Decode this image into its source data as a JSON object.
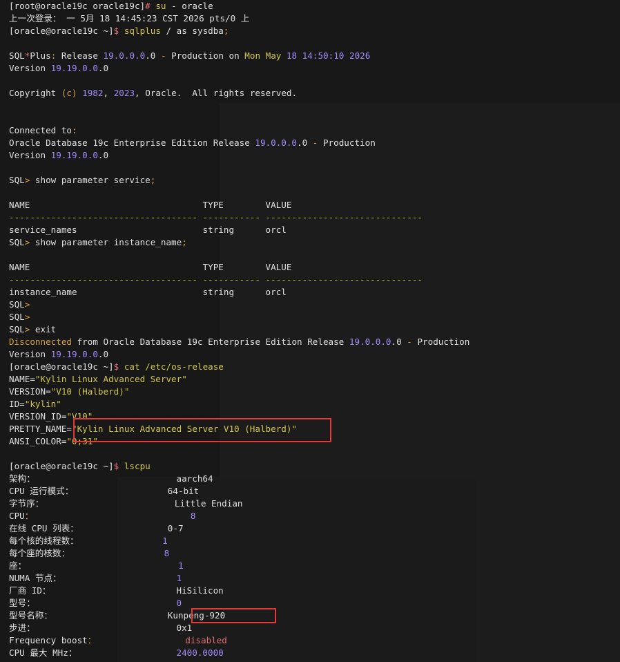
{
  "terminal": {
    "lines": [
      {
        "segments": [
          {
            "t": "[root@oracle19c oracle19c]",
            "c": "w"
          },
          {
            "t": "# ",
            "c": "r"
          },
          {
            "t": "su",
            "c": "y"
          },
          {
            "t": " - oracle",
            "c": "w"
          }
        ]
      },
      {
        "segments": [
          {
            "t": "上一次登录： 一 5月 18 14:45:23 CST 2026 pts/0 上",
            "c": "w"
          }
        ]
      },
      {
        "segments": [
          {
            "t": "[oracle@oracle19c ~]",
            "c": "w"
          },
          {
            "t": "$ ",
            "c": "r"
          },
          {
            "t": "sqlplus",
            "c": "y"
          },
          {
            "t": " / as sysdba",
            "c": "w"
          },
          {
            "t": ";",
            "c": "o"
          }
        ]
      },
      {
        "segments": [
          {
            "t": "",
            "c": "w"
          }
        ]
      },
      {
        "segments": [
          {
            "t": "SQL",
            "c": "w"
          },
          {
            "t": "*",
            "c": "r"
          },
          {
            "t": "Plus",
            "c": "w"
          },
          {
            "t": ":",
            "c": "o"
          },
          {
            "t": " Release ",
            "c": "w"
          },
          {
            "t": "19.0.0.0",
            "c": "p"
          },
          {
            "t": ".0 ",
            "c": "w"
          },
          {
            "t": "-",
            "c": "o"
          },
          {
            "t": " Production on ",
            "c": "w"
          },
          {
            "t": "Mon May ",
            "c": "g"
          },
          {
            "t": "18",
            "c": "p"
          },
          {
            "t": " ",
            "c": "w"
          },
          {
            "t": "14:50:10",
            "c": "p"
          },
          {
            "t": " ",
            "c": "w"
          },
          {
            "t": "2026",
            "c": "p"
          }
        ]
      },
      {
        "segments": [
          {
            "t": "Version ",
            "c": "w"
          },
          {
            "t": "19.19.0.0",
            "c": "p"
          },
          {
            "t": ".0",
            "c": "w"
          }
        ]
      },
      {
        "segments": [
          {
            "t": "",
            "c": "w"
          }
        ]
      },
      {
        "segments": [
          {
            "t": "Copyright ",
            "c": "w"
          },
          {
            "t": "(c)",
            "c": "o"
          },
          {
            "t": " ",
            "c": "w"
          },
          {
            "t": "1982",
            "c": "p"
          },
          {
            "t": ", ",
            "c": "w"
          },
          {
            "t": "2023",
            "c": "p"
          },
          {
            "t": ", Oracle.  All rights reserved.",
            "c": "w"
          }
        ]
      },
      {
        "segments": [
          {
            "t": "",
            "c": "w"
          }
        ]
      },
      {
        "segments": [
          {
            "t": "",
            "c": "w"
          }
        ]
      },
      {
        "segments": [
          {
            "t": "Connected to",
            "c": "w"
          },
          {
            "t": ":",
            "c": "o"
          }
        ]
      },
      {
        "segments": [
          {
            "t": "Oracle Database 19c Enterprise Edition Release ",
            "c": "w"
          },
          {
            "t": "19.0.0.0",
            "c": "p"
          },
          {
            "t": ".0 ",
            "c": "w"
          },
          {
            "t": "-",
            "c": "o"
          },
          {
            "t": " Production",
            "c": "w"
          }
        ]
      },
      {
        "segments": [
          {
            "t": "Version ",
            "c": "w"
          },
          {
            "t": "19.19.0.0",
            "c": "p"
          },
          {
            "t": ".0",
            "c": "w"
          }
        ]
      },
      {
        "segments": [
          {
            "t": "",
            "c": "w"
          }
        ]
      },
      {
        "segments": [
          {
            "t": "SQL",
            "c": "w"
          },
          {
            "t": ">",
            "c": "o"
          },
          {
            "t": " show parameter service",
            "c": "w"
          },
          {
            "t": ";",
            "c": "o"
          }
        ]
      },
      {
        "segments": [
          {
            "t": "",
            "c": "w"
          }
        ]
      },
      {
        "segments": [
          {
            "t": "NAME                                 TYPE        VALUE",
            "c": "w"
          }
        ]
      },
      {
        "segments": [
          {
            "t": "------------------------------------ ----------- ------------------------------",
            "c": "dash"
          }
        ]
      },
      {
        "segments": [
          {
            "t": "service_names                        string      orcl",
            "c": "w"
          }
        ]
      },
      {
        "segments": [
          {
            "t": "SQL",
            "c": "w"
          },
          {
            "t": ">",
            "c": "o"
          },
          {
            "t": " show parameter instance_name",
            "c": "w"
          },
          {
            "t": ";",
            "c": "o"
          }
        ]
      },
      {
        "segments": [
          {
            "t": "",
            "c": "w"
          }
        ]
      },
      {
        "segments": [
          {
            "t": "NAME                                 TYPE        VALUE",
            "c": "w"
          }
        ]
      },
      {
        "segments": [
          {
            "t": "------------------------------------ ----------- ------------------------------",
            "c": "dash"
          }
        ]
      },
      {
        "segments": [
          {
            "t": "instance_name                        string      orcl",
            "c": "w"
          }
        ]
      },
      {
        "segments": [
          {
            "t": "SQL",
            "c": "w"
          },
          {
            "t": ">",
            "c": "o"
          }
        ]
      },
      {
        "segments": [
          {
            "t": "SQL",
            "c": "w"
          },
          {
            "t": ">",
            "c": "o"
          }
        ]
      },
      {
        "segments": [
          {
            "t": "SQL",
            "c": "w"
          },
          {
            "t": ">",
            "c": "o"
          },
          {
            "t": " exit",
            "c": "w"
          }
        ]
      },
      {
        "segments": [
          {
            "t": "Disconnected",
            "c": "o"
          },
          {
            "t": " from Oracle Database 19c Enterprise Edition Release ",
            "c": "w"
          },
          {
            "t": "19.0.0.0",
            "c": "p"
          },
          {
            "t": ".0 ",
            "c": "w"
          },
          {
            "t": "-",
            "c": "o"
          },
          {
            "t": " Production",
            "c": "w"
          }
        ]
      },
      {
        "segments": [
          {
            "t": "Version ",
            "c": "w"
          },
          {
            "t": "19.19.0.0",
            "c": "p"
          },
          {
            "t": ".0",
            "c": "w"
          }
        ]
      },
      {
        "segments": [
          {
            "t": "[oracle@oracle19c ~]",
            "c": "w"
          },
          {
            "t": "$ ",
            "c": "r"
          },
          {
            "t": "cat",
            "c": "y"
          },
          {
            "t": " /etc/os-release",
            "c": "y"
          }
        ]
      },
      {
        "segments": [
          {
            "t": "NAME=",
            "c": "w"
          },
          {
            "t": "\"Kylin Linux Advanced Server\"",
            "c": "g"
          }
        ]
      },
      {
        "segments": [
          {
            "t": "VERSION=",
            "c": "w"
          },
          {
            "t": "\"V10 (Halberd)\"",
            "c": "g"
          }
        ]
      },
      {
        "segments": [
          {
            "t": "ID=",
            "c": "w"
          },
          {
            "t": "\"kylin\"",
            "c": "g"
          }
        ]
      },
      {
        "segments": [
          {
            "t": "VERSION_ID=",
            "c": "w"
          },
          {
            "t": "\"V10\"",
            "c": "g"
          }
        ]
      },
      {
        "segments": [
          {
            "t": "PRETTY_NAME=",
            "c": "w"
          },
          {
            "t": "\"Kylin Linux Advanced Server V10 (Halberd)\"",
            "c": "g"
          }
        ]
      },
      {
        "segments": [
          {
            "t": "ANSI_COLOR=",
            "c": "w"
          },
          {
            "t": "\"0;31\"",
            "c": "g"
          }
        ]
      },
      {
        "segments": [
          {
            "t": "",
            "c": "w"
          }
        ]
      },
      {
        "segments": [
          {
            "t": "[oracle@oracle19c ~]",
            "c": "w"
          },
          {
            "t": "$ ",
            "c": "r"
          },
          {
            "t": "lscpu",
            "c": "y"
          }
        ]
      },
      {
        "segments": [
          {
            "t": "架构：                           aarch64",
            "c": "w"
          }
        ]
      },
      {
        "segments": [
          {
            "t": "CPU 运行模式：                  64-bit",
            "c": "w"
          }
        ]
      },
      {
        "segments": [
          {
            "t": "字节序：                         Little Endian",
            "c": "w"
          }
        ]
      },
      {
        "segments": [
          {
            "t": "CPU",
            "c": "w"
          },
          {
            "t": "：                              ",
            "c": "o"
          },
          {
            "t": "8",
            "c": "p"
          }
        ]
      },
      {
        "segments": [
          {
            "t": "在线 CPU 列表：                 0-7",
            "c": "w"
          }
        ]
      },
      {
        "segments": [
          {
            "t": "每个核的线程数：                ",
            "c": "w"
          },
          {
            "t": "1",
            "c": "p"
          }
        ]
      },
      {
        "segments": [
          {
            "t": "每个座的核数：                  ",
            "c": "w"
          },
          {
            "t": "8",
            "c": "p"
          }
        ]
      },
      {
        "segments": [
          {
            "t": "座：                             ",
            "c": "w"
          },
          {
            "t": "1",
            "c": "p"
          }
        ]
      },
      {
        "segments": [
          {
            "t": "NUMA 节点：                      ",
            "c": "w"
          },
          {
            "t": "1",
            "c": "p"
          }
        ]
      },
      {
        "segments": [
          {
            "t": "厂商 ID：                        HiSilicon",
            "c": "w"
          }
        ]
      },
      {
        "segments": [
          {
            "t": "型号：                           ",
            "c": "w"
          },
          {
            "t": "0",
            "c": "p"
          }
        ]
      },
      {
        "segments": [
          {
            "t": "型号名称：                      Kunpeng-920",
            "c": "w"
          }
        ]
      },
      {
        "segments": [
          {
            "t": "步进：                           0x1",
            "c": "w"
          }
        ]
      },
      {
        "segments": [
          {
            "t": "Frequency boost",
            "c": "w"
          },
          {
            "t": "：                 ",
            "c": "o"
          },
          {
            "t": "disabled",
            "c": "r"
          }
        ]
      },
      {
        "segments": [
          {
            "t": "CPU 最大 MHz：                   ",
            "c": "w"
          },
          {
            "t": "2400.0000",
            "c": "p"
          }
        ]
      }
    ]
  },
  "highlights": [
    {
      "label": "pretty-name-highlight"
    },
    {
      "label": "model-name-highlight"
    }
  ]
}
